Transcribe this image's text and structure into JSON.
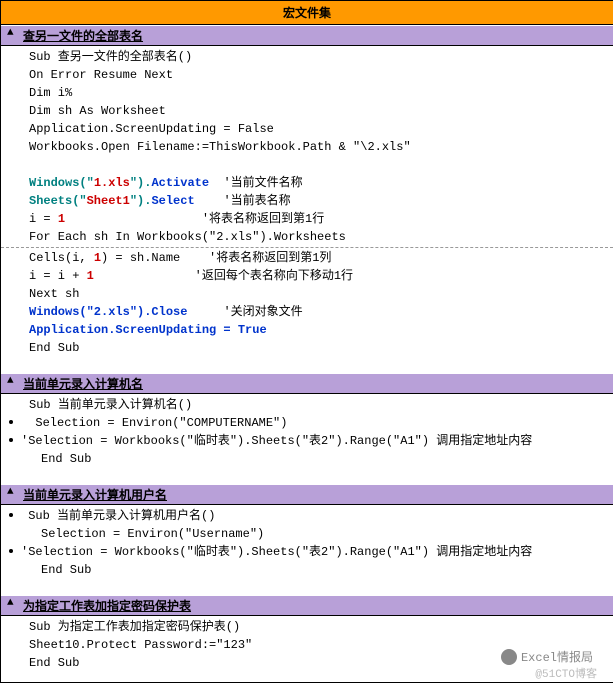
{
  "title": "宏文件集",
  "sections": [
    {
      "header": "查另一文件的全部表名",
      "lines": [
        {
          "cls": "indent1",
          "parts": [
            {
              "t": "Sub 查另一文件的全部表名()"
            }
          ]
        },
        {
          "cls": "indent1",
          "parts": [
            {
              "t": "On Error Resume Next"
            }
          ]
        },
        {
          "cls": "indent1",
          "parts": [
            {
              "t": "Dim i%"
            }
          ]
        },
        {
          "cls": "indent1",
          "parts": [
            {
              "t": "Dim sh As Worksheet"
            }
          ]
        },
        {
          "cls": "indent1",
          "parts": [
            {
              "t": "Application.ScreenUpdating = False"
            }
          ]
        },
        {
          "cls": "indent1",
          "parts": [
            {
              "t": "Workbooks.Open Filename:=ThisWorkbook.Path & \"\\2.xls\""
            }
          ]
        },
        {
          "cls": "indent1",
          "parts": [
            {
              "t": " "
            }
          ]
        },
        {
          "cls": "indent1",
          "parts": [
            {
              "t": "Windows(\"",
              "c": "teal-bold"
            },
            {
              "t": "1.xls",
              "c": "red-bold"
            },
            {
              "t": "\").",
              "c": "teal-bold"
            },
            {
              "t": "Activate",
              "c": "blue-bold"
            },
            {
              "t": "  '当前文件名称"
            }
          ]
        },
        {
          "cls": "indent1",
          "parts": [
            {
              "t": "Sheets(\"",
              "c": "teal-bold"
            },
            {
              "t": "Sheet1",
              "c": "red-bold"
            },
            {
              "t": "\").",
              "c": "teal-bold"
            },
            {
              "t": "Select",
              "c": "blue-bold"
            },
            {
              "t": "    '当前表名称"
            }
          ]
        },
        {
          "cls": "indent1",
          "parts": [
            {
              "t": "i = "
            },
            {
              "t": "1",
              "c": "red-bold"
            },
            {
              "t": "                   '将表名称返回到第1行"
            }
          ]
        },
        {
          "cls": "indent1",
          "parts": [
            {
              "t": "For Each sh In Workbooks(\"2.xls\").Worksheets"
            }
          ]
        },
        {
          "divider": true
        },
        {
          "cls": "indent1",
          "parts": [
            {
              "t": "Cells(i, "
            },
            {
              "t": "1",
              "c": "red-bold"
            },
            {
              "t": ") = sh.Name    '将表名称返回到第1列"
            }
          ]
        },
        {
          "cls": "indent1",
          "parts": [
            {
              "t": "i = i + "
            },
            {
              "t": "1",
              "c": "red-bold"
            },
            {
              "t": "              '返回每个表名称向下移动1行"
            }
          ]
        },
        {
          "cls": "indent1",
          "parts": [
            {
              "t": "Next sh"
            }
          ]
        },
        {
          "cls": "indent1",
          "parts": [
            {
              "t": "Windows(\"2.xls\").Close",
              "c": "blue-bold"
            },
            {
              "t": "     '关闭对象文件"
            }
          ]
        },
        {
          "cls": "indent1",
          "parts": [
            {
              "t": "Application.ScreenUpdating = True",
              "c": "blue-bold"
            }
          ]
        },
        {
          "cls": "indent1",
          "parts": [
            {
              "t": "End Sub"
            }
          ]
        }
      ]
    },
    {
      "header": "当前单元录入计算机名",
      "lines": [
        {
          "cls": "indent1",
          "parts": [
            {
              "t": "Sub 当前单元录入计算机名()"
            }
          ]
        },
        {
          "bullet": true,
          "parts": [
            {
              "t": "  Selection = Environ(\"COMPUTERNAME\")"
            }
          ]
        },
        {
          "bullet": true,
          "parts": [
            {
              "t": "'Selection = Workbooks(\"临时表\").Sheets(\"表2\").Range(\"A1\") 调用指定地址内容"
            }
          ]
        },
        {
          "cls": "indent2",
          "parts": [
            {
              "t": "End Sub"
            }
          ]
        }
      ]
    },
    {
      "header": "当前单元录入计算机用户名",
      "lines": [
        {
          "bullet": true,
          "parts": [
            {
              "t": " Sub 当前单元录入计算机用户名()"
            }
          ]
        },
        {
          "cls": "indent2",
          "parts": [
            {
              "t": "Selection = Environ(\"Username\")"
            }
          ]
        },
        {
          "bullet": true,
          "parts": [
            {
              "t": "'Selection = Workbooks(\"临时表\").Sheets(\"表2\").Range(\"A1\") 调用指定地址内容"
            }
          ]
        },
        {
          "cls": "indent2",
          "parts": [
            {
              "t": "End Sub"
            }
          ]
        }
      ]
    },
    {
      "header": "为指定工作表加指定密码保护表",
      "lines": [
        {
          "cls": "indent1",
          "parts": [
            {
              "t": "Sub 为指定工作表加指定密码保护表()"
            }
          ]
        },
        {
          "cls": "indent1",
          "parts": [
            {
              "t": "Sheet10.Protect Password:=\"123\""
            }
          ]
        },
        {
          "cls": "indent1",
          "parts": [
            {
              "t": "End Sub"
            }
          ]
        }
      ]
    }
  ],
  "watermark": "Excel情报局",
  "lowmark": "@51CTO博客"
}
